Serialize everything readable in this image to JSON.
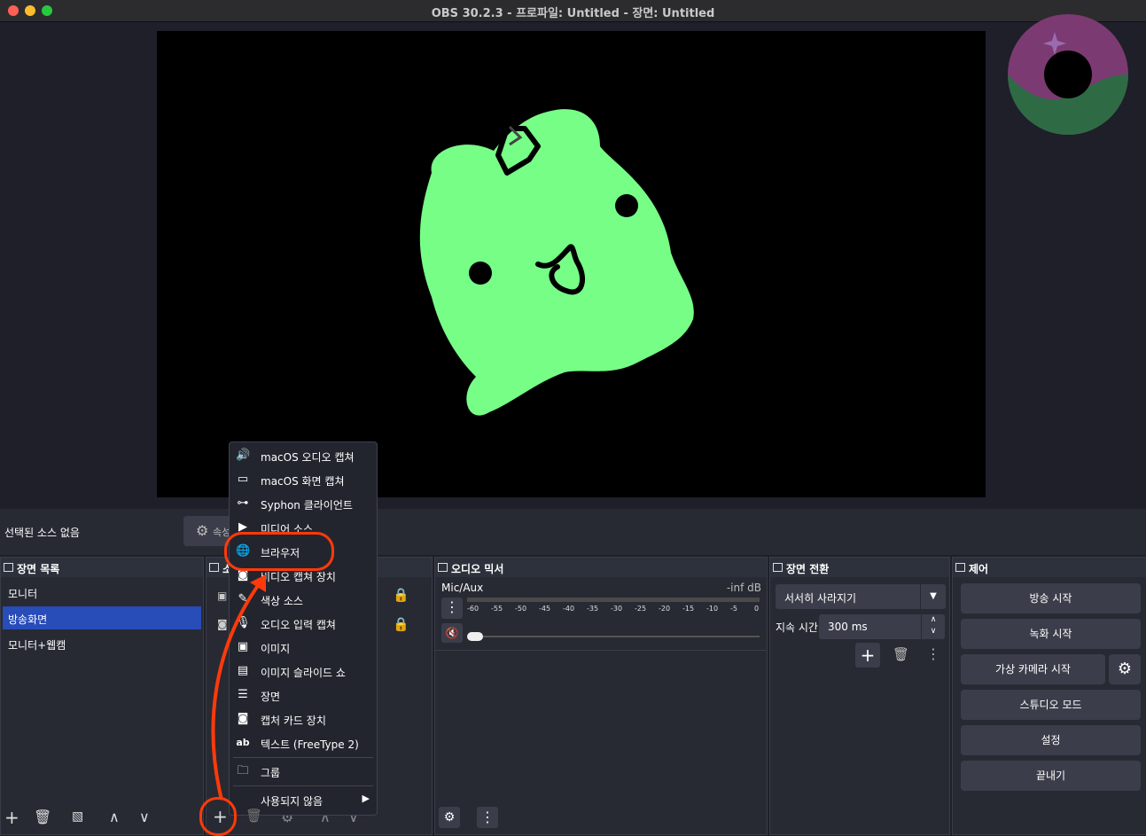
{
  "window": {
    "title": "OBS 30.2.3 - 프로파일: Untitled - 장면: Untitled"
  },
  "colors": {
    "accent": "#284cb8",
    "annotation": "#ff3a0a",
    "mascot": "#76fe87"
  },
  "source_bar": {
    "no_source": "선택된 소스 없음",
    "properties": "속성"
  },
  "scenes": {
    "title": "장면 목록",
    "items": [
      {
        "label": "모니터"
      },
      {
        "label": "방송화면"
      },
      {
        "label": "모니터+웹캠"
      }
    ],
    "selected": 1
  },
  "sources": {
    "title": "소"
  },
  "mixer": {
    "title": "오디오 믹서",
    "channel": "Mic/Aux",
    "level": "-inf dB",
    "ticks": [
      "-60",
      "-55",
      "-50",
      "-45",
      "-40",
      "-35",
      "-30",
      "-25",
      "-20",
      "-15",
      "-10",
      "-5",
      "0"
    ]
  },
  "transitions": {
    "title": "장면 전환",
    "type": "서서히 사라지기",
    "duration_label": "지속 시간",
    "duration": "300 ms"
  },
  "controls": {
    "title": "제어",
    "buttons": [
      "방송 시작",
      "녹화 시작",
      "가상 카메라 시작",
      "스튜디오 모드",
      "설정",
      "끝내기"
    ]
  },
  "menu": {
    "items": [
      {
        "label": "macOS 오디오 캡쳐",
        "icon": "speaker-icon"
      },
      {
        "label": "macOS 화면 캡쳐",
        "icon": "monitor-icon"
      },
      {
        "label": "Syphon 클라이언트",
        "icon": "gamepad-icon"
      },
      {
        "label": "미디어 소스",
        "icon": "play-icon"
      },
      {
        "label": "브라우저",
        "icon": "globe-icon"
      },
      {
        "label": "비디오 캡쳐 장치",
        "icon": "camera-icon"
      },
      {
        "label": "색상 소스",
        "icon": "brush-icon"
      },
      {
        "label": "오디오 입력 캡쳐",
        "icon": "microphone-icon"
      },
      {
        "label": "이미지",
        "icon": "image-icon"
      },
      {
        "label": "이미지 슬라이드 쇼",
        "icon": "slideshow-icon"
      },
      {
        "label": "장면",
        "icon": "list-icon"
      },
      {
        "label": "캡처 카드 장치",
        "icon": "camera-icon"
      },
      {
        "label": "텍스트 (FreeType 2)",
        "icon": "text-icon"
      },
      {
        "label": "그룹",
        "icon": "folder-icon"
      },
      {
        "label": "사용되지 않음",
        "icon": "chevron-right-icon"
      }
    ]
  }
}
